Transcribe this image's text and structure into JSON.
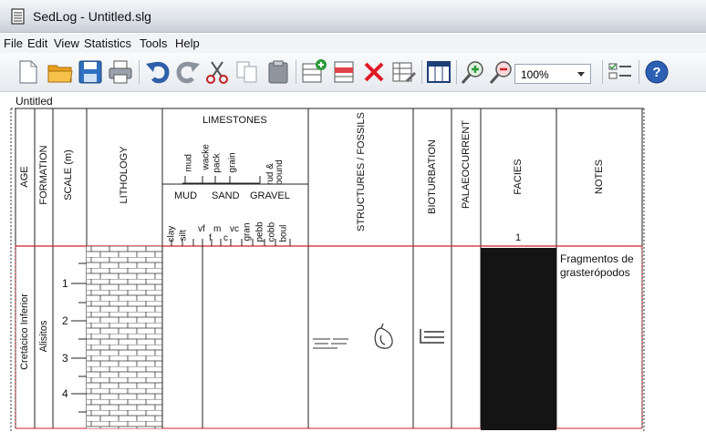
{
  "window": {
    "title": "SedLog - Untitled.slg"
  },
  "menu": [
    "File",
    "Edit",
    "View",
    "Statistics",
    "Tools",
    "Help"
  ],
  "toolbar": {
    "buttons": [
      "new-icon",
      "open-icon",
      "save-icon",
      "print-icon",
      "undo-icon",
      "redo-icon",
      "cut-icon",
      "copy-icon",
      "paste-icon",
      "insert-bed-icon",
      "insert-row-icon",
      "delete-icon",
      "edit-grid-icon",
      "columns-icon",
      "zoom-in-icon",
      "zoom-out-icon",
      "options-icon",
      "help-icon"
    ],
    "zoom_value": "100%"
  },
  "document": {
    "title": "Untitled",
    "headers": {
      "age": "AGE",
      "formation": "FORMATION",
      "scale": "SCALE (m)",
      "lithology": "LITHOLOGY",
      "limestones": "LIMESTONES",
      "limestone_types": [
        "mud",
        "wacke",
        "pack",
        "grain",
        "rud & bound"
      ],
      "grain_groups": [
        "MUD",
        "SAND",
        "GRAVEL"
      ],
      "grain_sizes": [
        "clay",
        "silt",
        "vf",
        "f",
        "m",
        "c",
        "vc",
        "gran",
        "pebb",
        "cobb",
        "boul"
      ],
      "structures": "STRUCTURES / FOSSILS",
      "bioturbation": "BIOTURBATION",
      "palaeocurrent": "PALAEOCURRENT",
      "facies": "FACIES",
      "facies_number": "1",
      "notes": "NOTES"
    },
    "rows": [
      {
        "age": "Cretácico Inferior",
        "formation": "Alisitos",
        "scale_ticks": [
          "1",
          "2",
          "3",
          "4"
        ],
        "notes_line1": "Fragmentos de",
        "notes_line2": "grasterópodos",
        "facies_color": "#141414"
      }
    ]
  },
  "colors": {
    "grid_red": "#d0202a",
    "titlebar_accent": "#dfe4ea"
  }
}
